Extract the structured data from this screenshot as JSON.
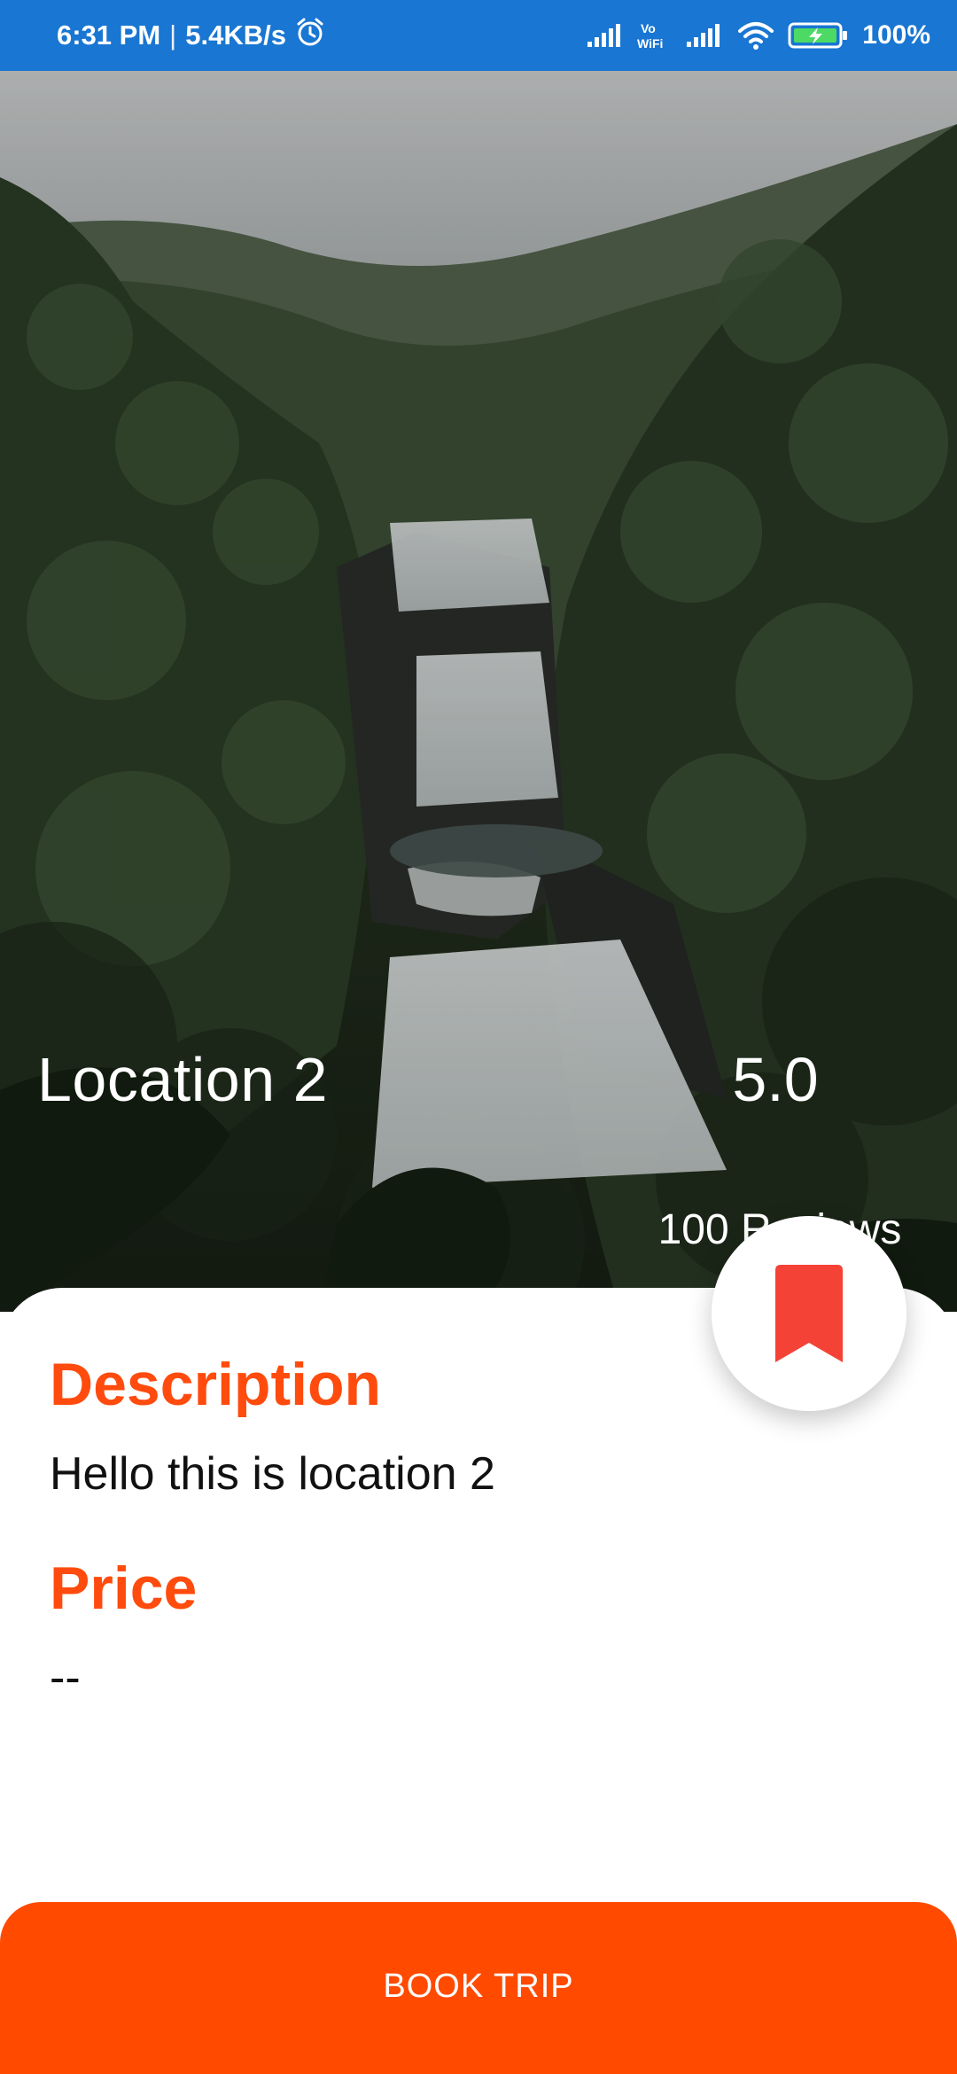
{
  "status_bar": {
    "time": "6:31 PM",
    "network_speed": "5.4KB/s",
    "battery": "100%",
    "icons": [
      "alarm-icon",
      "signal-icon",
      "vowifi-icon",
      "signal-icon",
      "wifi-icon",
      "battery-charging-icon"
    ]
  },
  "hero": {
    "location_name": "Location 2",
    "rating": "5.0",
    "reviews": "100 Reviews"
  },
  "details": {
    "description_label": "Description",
    "description_text": "Hello this is location 2",
    "price_label": "Price",
    "price_value": "--"
  },
  "actions": {
    "bookmark_icon": "bookmark-icon",
    "book_trip_label": "BOOK TRIP"
  },
  "colors": {
    "status_bar": "#1976d2",
    "accent": "#ff4a00",
    "bookmark": "#f44336"
  }
}
